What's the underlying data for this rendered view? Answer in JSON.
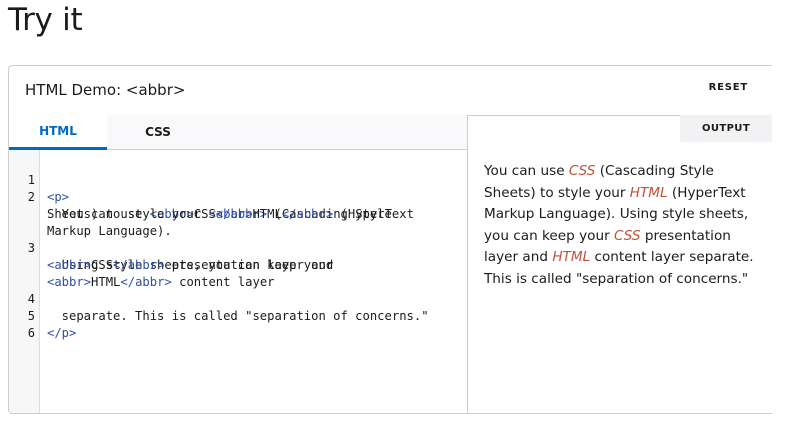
{
  "page": {
    "title": "Try it"
  },
  "demo": {
    "title": "HTML Demo: <abbr>",
    "reset_label": "RESET"
  },
  "tabs": [
    {
      "label": "HTML",
      "active": true
    },
    {
      "label": "CSS",
      "active": false
    }
  ],
  "code": {
    "line_numbers": [
      "1",
      "2",
      "3",
      "4",
      "5",
      "6"
    ],
    "lines": {
      "l1": "<p>",
      "l2a_1": "  You can use ",
      "l2a_t1": "<abbr>",
      "l2a_2": "CSS",
      "l2a_t2": "</abbr>",
      "l2a_3": " (Cascading Style",
      "l2b_1": "Sheets) to style your ",
      "l2b_t1": "<abbr>",
      "l2b_2": "HTML",
      "l2b_t2": "</abbr>",
      "l2b_3": " (HyperText",
      "l2c": "Markup Language).",
      "l3a": "  Using style sheets, you can keep your",
      "l3b_t1": "<abbr>",
      "l3b_2": "CSS",
      "l3b_t2": "</abbr>",
      "l3b_3": " presentation layer and",
      "l3c_t1": "<abbr>",
      "l3c_2": "HTML",
      "l3c_t2": "</abbr>",
      "l3c_3": " content layer",
      "l4": "  separate. This is called \"separation of concerns.\"",
      "l5": "</p>",
      "l6": ""
    }
  },
  "output": {
    "label": "OUTPUT",
    "seg1": "You can use ",
    "abbr1": "CSS",
    "seg2": " (Cascading Style Sheets) to style your ",
    "abbr2": "HTML",
    "seg3": " (HyperText Markup Language). Using style sheets, you can keep your ",
    "abbr3": "CSS",
    "seg4": " presentation layer and ",
    "abbr4": "HTML",
    "seg5": " content layer separate. This is called \"separation of concerns.\""
  },
  "colors": {
    "accent": "#0069c2",
    "tag": "#2e4fa3",
    "abbr_output": "#c0523b",
    "border": "#cdcdcd"
  }
}
